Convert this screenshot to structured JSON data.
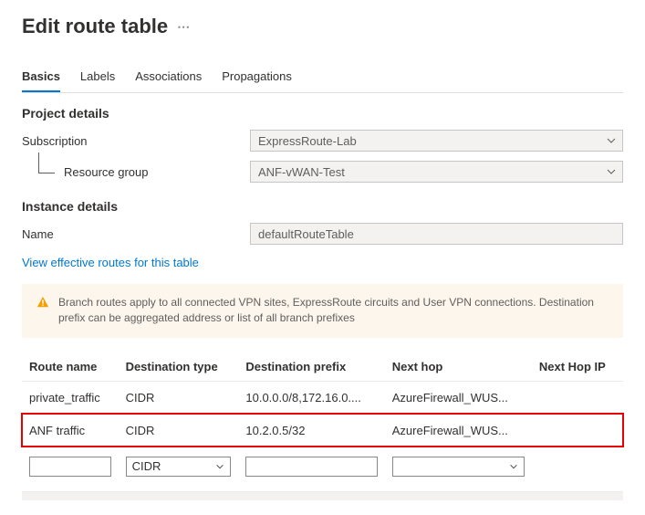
{
  "title": "Edit route table",
  "tabs": [
    "Basics",
    "Labels",
    "Associations",
    "Propagations"
  ],
  "activeTab": 0,
  "projectDetails": {
    "header": "Project details",
    "subscriptionLabel": "Subscription",
    "subscriptionValue": "ExpressRoute-Lab",
    "resourceGroupLabel": "Resource group",
    "resourceGroupValue": "ANF-vWAN-Test"
  },
  "instanceDetails": {
    "header": "Instance details",
    "nameLabel": "Name",
    "nameValue": "defaultRouteTable"
  },
  "linkText": "View effective routes for this table",
  "noticeText": "Branch routes apply to all connected VPN sites, ExpressRoute circuits and User VPN connections. Destination prefix can be aggregated address or list of all branch prefixes",
  "table": {
    "headers": [
      "Route name",
      "Destination type",
      "Destination prefix",
      "Next hop",
      "Next Hop IP"
    ],
    "rows": [
      {
        "name": "private_traffic",
        "type": "CIDR",
        "prefix": "10.0.0.0/8,172.16.0....",
        "hop": "AzureFirewall_WUS...",
        "ip": ""
      },
      {
        "name": "ANF traffic",
        "type": "CIDR",
        "prefix": "10.2.0.5/32",
        "hop": "AzureFirewall_WUS...",
        "ip": "",
        "highlighted": true
      }
    ],
    "editor": {
      "typeDefault": "CIDR"
    }
  }
}
